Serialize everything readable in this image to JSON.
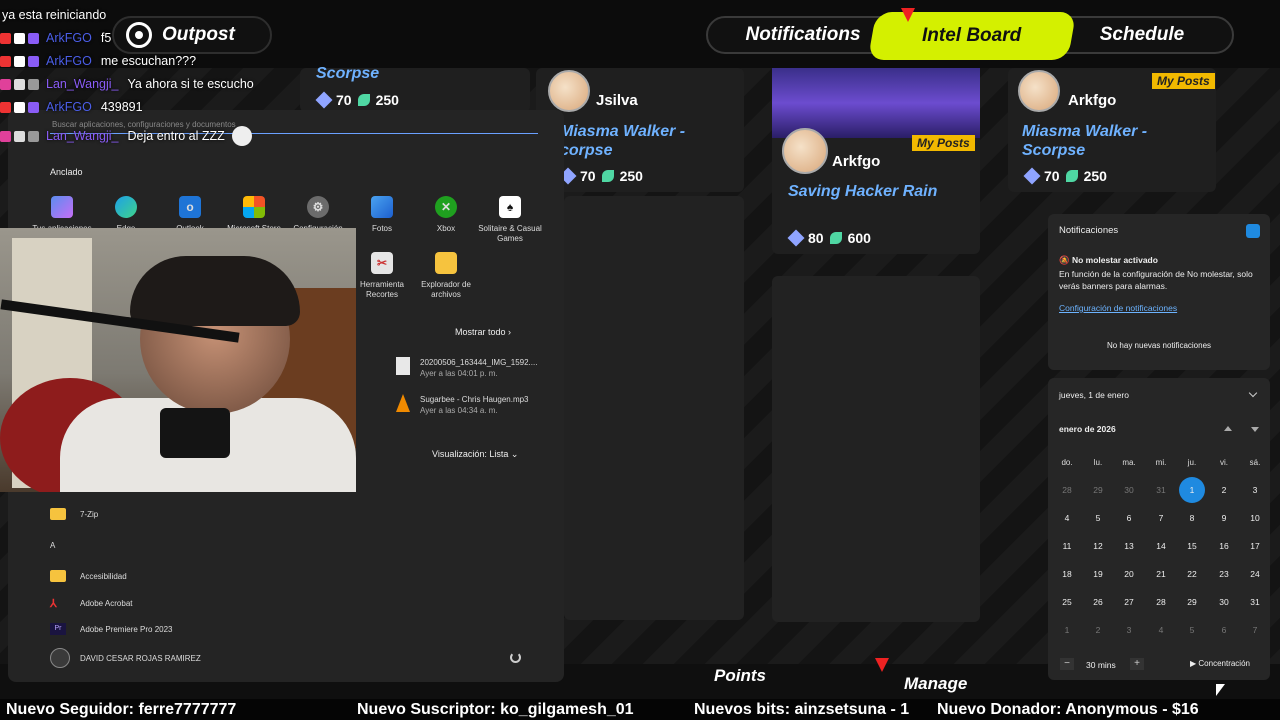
{
  "game": {
    "outpost_label": "Outpost",
    "tabs": [
      "Notifications",
      "Intel Board",
      "Schedule"
    ],
    "cards": [
      {
        "user": "",
        "title": "Scorpse",
        "gems": "70",
        "leaves": "250"
      },
      {
        "user": "Jsilva",
        "title": "Miasma Walker - corpse",
        "gems": "70",
        "leaves": "250"
      },
      {
        "user": "Arkfgo",
        "title": "Saving Hacker Rain",
        "gems": "80",
        "leaves": "600",
        "badge": "My Posts"
      },
      {
        "user": "Arkfgo",
        "title": "Miasma Walker - Scorpse",
        "gems": "70",
        "leaves": "250",
        "badge": "My Posts"
      }
    ],
    "bottom_nav": [
      "Points",
      "Manage"
    ]
  },
  "chat": [
    {
      "user": "",
      "message": "ya esta reiniciando"
    },
    {
      "user": "ArkFGO",
      "message": "f5"
    },
    {
      "user": "ArkFGO",
      "message": "me escuchan???"
    },
    {
      "user": "Lan_Wangji_",
      "message": "Ya ahora si te escucho"
    },
    {
      "user": "ArkFGO",
      "message": "439891"
    },
    {
      "user": "Lan_Wangji_",
      "message": "Deja entro al ZZZ"
    }
  ],
  "start_menu": {
    "search_placeholder": "Buscar aplicaciones, configuraciones y documentos",
    "pinned_label": "Anclado",
    "pinned_apps": [
      "Tus aplicaciones",
      "Edge",
      "Outlook",
      "Microsoft Store",
      "Configuración",
      "Fotos",
      "Xbox",
      "Solitaire & Casual Games",
      "Herramienta Recortes",
      "Explorador de archivos"
    ],
    "show_all": "Mostrar todo",
    "recent": [
      {
        "name": "20200506_163444_IMG_1592....",
        "time": "Ayer a las 04:01 p. m."
      },
      {
        "name": "Sugarbee - Chris Haugen.mp3",
        "time": "Ayer a las 04:34 a. m."
      }
    ],
    "view_label": "Visualización: Lista",
    "all_apps": [
      "7-Zip",
      "A",
      "Accesibilidad",
      "Adobe Acrobat",
      "Adobe Premiere Pro 2023"
    ],
    "user_name": "DAVID CESAR ROJAS RAMIREZ"
  },
  "notifications": {
    "title": "Notificaciones",
    "dnd_title": "No molestar activado",
    "dnd_body": "En función de la configuración de No molestar, solo verás banners para alarmas.",
    "settings_link": "Configuración de notificaciones",
    "empty": "No hay nuevas notificaciones"
  },
  "calendar": {
    "date_header": "jueves, 1 de enero",
    "month": "enero de 2026",
    "weekdays": [
      "do.",
      "lu.",
      "ma.",
      "mi.",
      "ju.",
      "vi.",
      "sá."
    ],
    "weeks": [
      [
        "28",
        "29",
        "30",
        "31",
        "1",
        "2",
        "3"
      ],
      [
        "4",
        "5",
        "6",
        "7",
        "8",
        "9",
        "10"
      ],
      [
        "11",
        "12",
        "13",
        "14",
        "15",
        "16",
        "17"
      ],
      [
        "18",
        "19",
        "20",
        "21",
        "22",
        "23",
        "24"
      ],
      [
        "25",
        "26",
        "27",
        "28",
        "29",
        "30",
        "31"
      ],
      [
        "1",
        "2",
        "3",
        "4",
        "5",
        "6",
        "7"
      ]
    ],
    "focus_minutes": "30 mins",
    "focus_label": "Concentración"
  },
  "ticker": [
    "Nuevo Seguidor: ferre7777777",
    "Nuevo Suscriptor: ko_gilgamesh_01",
    "Nuevos bits: ainzsetsuna - 1",
    "Nuevo Donador: Anonymous - $16"
  ],
  "colors": {
    "accent": "#d4f000",
    "windows_blue": "#1f8ae0",
    "chat_user": "#8a5cf6"
  }
}
